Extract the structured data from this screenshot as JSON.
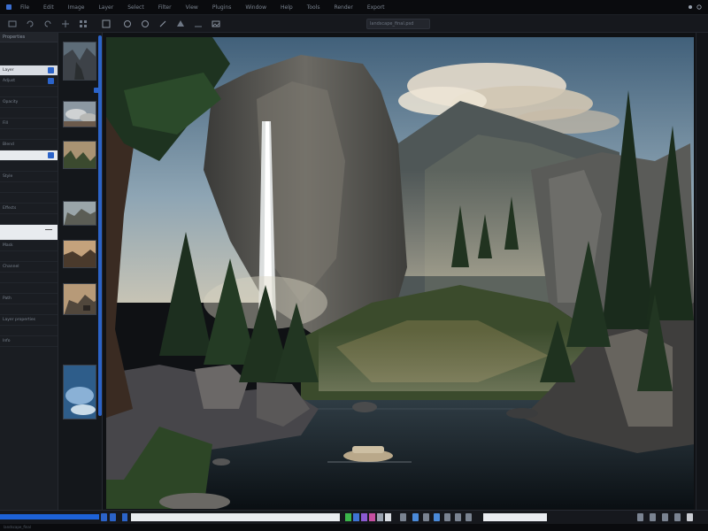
{
  "menubar": {
    "items": [
      "File",
      "Edit",
      "Image",
      "Layer",
      "Select",
      "Filter",
      "View",
      "Plugins",
      "Window",
      "Help",
      "Tools",
      "Render",
      "Export"
    ]
  },
  "toolbar": {
    "document_title": "landscape_final.psd"
  },
  "left_panel": {
    "header": "Properties",
    "rows": [
      {
        "label": "",
        "style": "plain"
      },
      {
        "label": "Layer",
        "style": "active",
        "check": true
      },
      {
        "label": "Adjust",
        "style": "plain",
        "check": true
      },
      {
        "label": "",
        "style": "plain"
      },
      {
        "label": "Opacity",
        "style": "plain"
      },
      {
        "label": "",
        "style": "plain"
      },
      {
        "label": "Fill",
        "style": "plain"
      },
      {
        "label": "",
        "style": "plain"
      },
      {
        "label": "Blend",
        "style": "plain"
      },
      {
        "label": "",
        "style": "white",
        "check": true
      },
      {
        "label": "",
        "style": "plain"
      },
      {
        "label": "Style",
        "style": "plain"
      },
      {
        "label": "",
        "style": "plain"
      },
      {
        "label": "",
        "style": "plain"
      },
      {
        "label": "Effects",
        "style": "plain"
      },
      {
        "label": "",
        "style": "plain"
      },
      {
        "label": "",
        "style": "white"
      },
      {
        "label": "Mask",
        "style": "plain"
      },
      {
        "label": "",
        "style": "plain"
      },
      {
        "label": "Channel",
        "style": "plain"
      },
      {
        "label": "",
        "style": "plain"
      },
      {
        "label": "",
        "style": "plain"
      },
      {
        "label": "Path",
        "style": "plain"
      },
      {
        "label": "",
        "style": "plain"
      },
      {
        "label": "Layer properties",
        "style": "plain"
      },
      {
        "label": "",
        "style": "plain"
      },
      {
        "label": "Info",
        "style": "plain"
      }
    ]
  },
  "thumbnails": [
    "canyon",
    "clouds",
    "forest",
    "cliffs",
    "lake",
    "mountain",
    "sky"
  ],
  "footer": {
    "text": "landscape_final"
  },
  "colors": {
    "accent": "#2b63c9",
    "progress": "#1d62d8",
    "sky": "#6f8fa6",
    "cliff": "#4a4a48",
    "forest": "#1f3325",
    "water": "#141b20"
  }
}
